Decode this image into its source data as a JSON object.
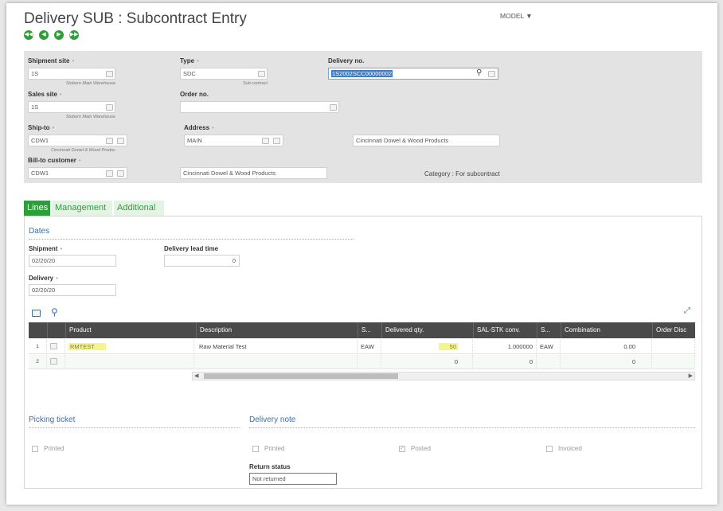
{
  "header": {
    "title": "Delivery SUB : Subcontract Entry",
    "model_label": "MODEL"
  },
  "nav": {
    "first_icon": "first-record-icon",
    "prev_icon": "previous-record-icon",
    "next_icon": "next-record-icon",
    "last_icon": "last-record-icon"
  },
  "fields": {
    "shipment_site": {
      "label": "Shipment site",
      "value": "1S",
      "sub": "Stoborn Main Warehouse"
    },
    "type": {
      "label": "Type",
      "value": "SDC",
      "sub": "Sub contract"
    },
    "delivery_no": {
      "label": "Delivery no.",
      "value": "1S2002SCC00000002"
    },
    "sales_site": {
      "label": "Sales site",
      "value": "1S",
      "sub": "Stoborn Main Warehouse"
    },
    "order_no": {
      "label": "Order no.",
      "value": ""
    },
    "ship_to": {
      "label": "Ship-to",
      "value": "CDW1",
      "sub": "Cincinnati Dowel & Wood Produc"
    },
    "address": {
      "label": "Address",
      "value": "MAIN",
      "desc": "Cincinnati Dowel & Wood Products"
    },
    "bill_to": {
      "label": "Bill-to customer",
      "value": "CDW1",
      "desc": "Cincinnati Dowel & Wood Products"
    },
    "category": "Category : For subcontract"
  },
  "tabs": [
    {
      "label": "Lines"
    },
    {
      "label": "Management"
    },
    {
      "label": "Additional"
    }
  ],
  "dates": {
    "section_title": "Dates",
    "shipment_label": "Shipment",
    "shipment_value": "02/20/20",
    "lead_time_label": "Delivery lead time",
    "lead_time_value": "0",
    "delivery_label": "Delivery",
    "delivery_value": "02/20/20"
  },
  "grid": {
    "columns": [
      "Product",
      "Description",
      "S...",
      "Delivered qty.",
      "SAL-STK conv.",
      "S...",
      "Combination",
      "Order Disc"
    ],
    "rows": [
      {
        "num": "1",
        "product": "RMTEST",
        "description": "Raw Material Test",
        "s1": "EAW",
        "qty": "50",
        "conv": "1.000000",
        "s2": "EAW",
        "combination": "0.00"
      },
      {
        "num": "2",
        "product": "",
        "description": "",
        "s1": "",
        "qty": "0",
        "conv": "0",
        "s2": "",
        "combination": "0"
      }
    ]
  },
  "picking": {
    "section_title": "Picking ticket",
    "printed_label": "Printed"
  },
  "delivery_note": {
    "section_title": "Delivery note",
    "printed_label": "Printed",
    "posted_label": "Posted",
    "invoiced_label": "Invoiced",
    "return_status_label": "Return status",
    "return_status_value": "Not returned"
  },
  "colors": {
    "accent": "#2e9e3a",
    "section_blue": "#3a6fa8",
    "grid_header": "#4a4a4a"
  }
}
